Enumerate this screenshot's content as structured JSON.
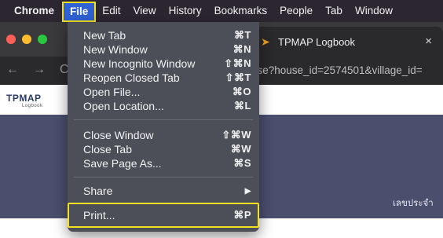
{
  "menubar": {
    "app": "Chrome",
    "items": [
      "File",
      "Edit",
      "View",
      "History",
      "Bookmarks",
      "People",
      "Tab",
      "Window"
    ]
  },
  "browser": {
    "tab_title": "TPMAP Logbook",
    "tab_close": "×",
    "url_fragment": "use?house_id=2574501&village_id=",
    "page_logo": "TPMAP",
    "page_logo_sub": "Logbook",
    "page_text": "เลขประจำ"
  },
  "file_menu": {
    "new_tab": {
      "label": "New Tab",
      "shortcut": "⌘T"
    },
    "new_window": {
      "label": "New Window",
      "shortcut": "⌘N"
    },
    "new_incognito": {
      "label": "New Incognito Window",
      "shortcut": "⇧⌘N"
    },
    "reopen_closed": {
      "label": "Reopen Closed Tab",
      "shortcut": "⇧⌘T"
    },
    "open_file": {
      "label": "Open File...",
      "shortcut": "⌘O"
    },
    "open_location": {
      "label": "Open Location...",
      "shortcut": "⌘L"
    },
    "close_window": {
      "label": "Close Window",
      "shortcut": "⇧⌘W"
    },
    "close_tab": {
      "label": "Close Tab",
      "shortcut": "⌘W"
    },
    "save_page": {
      "label": "Save Page As...",
      "shortcut": "⌘S"
    },
    "share": {
      "label": "Share",
      "shortcut": "▶"
    },
    "print": {
      "label": "Print...",
      "shortcut": "⌘P"
    }
  },
  "colors": {
    "highlight": "#f2e021",
    "menu_active": "#2f62d6"
  }
}
